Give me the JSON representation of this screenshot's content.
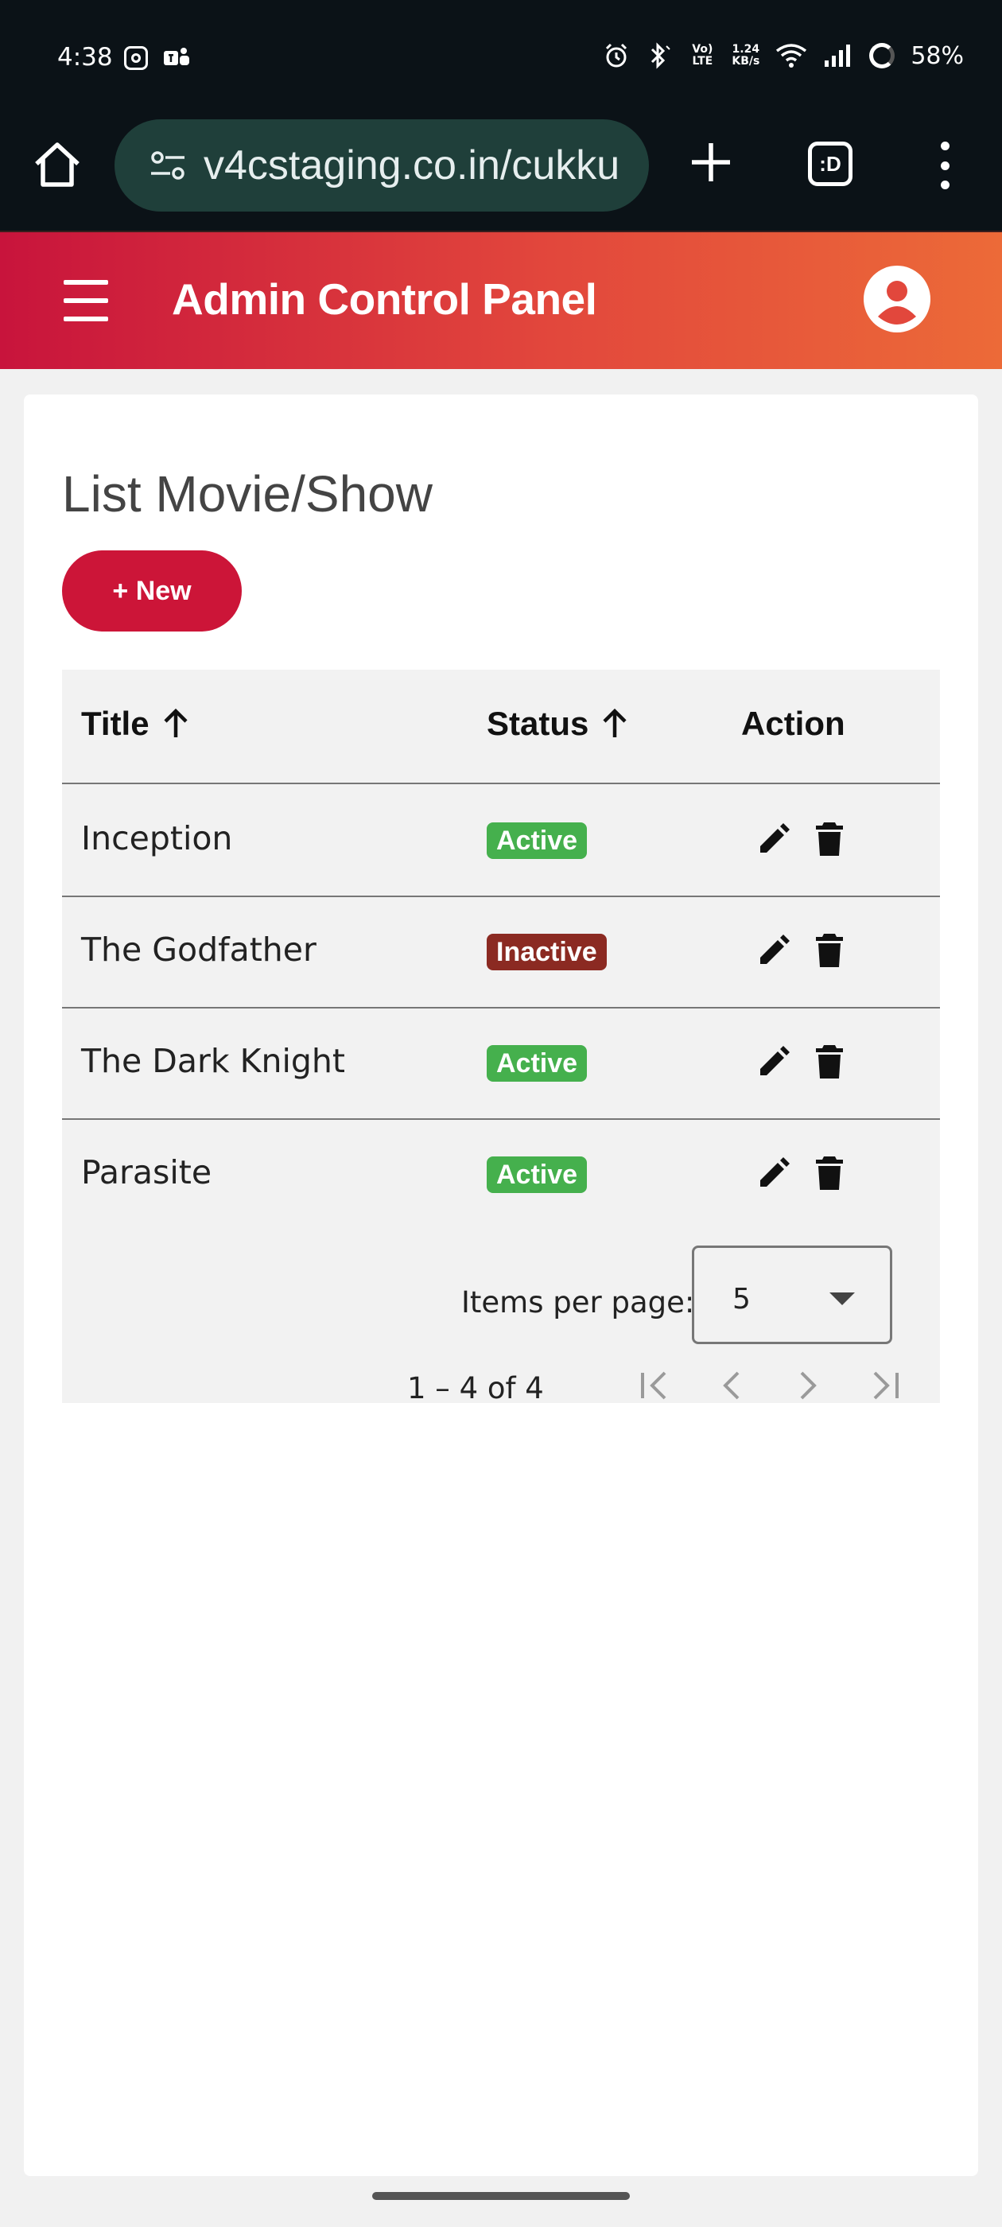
{
  "status_bar": {
    "time": "4:38",
    "volte": "Vo) LTE",
    "net_speed_top": "1.24",
    "net_speed_bottom": "KB/s",
    "battery": "58%"
  },
  "browser": {
    "url": "v4cstaging.co.in/cukku",
    "tabs_label": ":D"
  },
  "app": {
    "title": "Admin Control Panel",
    "colors": {
      "primary": "#cc1538",
      "gradient_end": "#ec6a38",
      "active": "#45b04d",
      "inactive": "#8b2a22"
    }
  },
  "page": {
    "heading": "List Movie/Show",
    "new_button": "+ New"
  },
  "table": {
    "headers": {
      "title": "Title",
      "status": "Status",
      "action": "Action"
    },
    "rows": [
      {
        "title": "Inception",
        "status": "Active"
      },
      {
        "title": "The Godfather",
        "status": "Inactive"
      },
      {
        "title": "The Dark Knight",
        "status": "Active"
      },
      {
        "title": "Parasite",
        "status": "Active"
      }
    ]
  },
  "paginator": {
    "items_per_page_label": "Items per page:",
    "items_per_page_value": "5",
    "range_label": "1 – 4 of 4"
  }
}
